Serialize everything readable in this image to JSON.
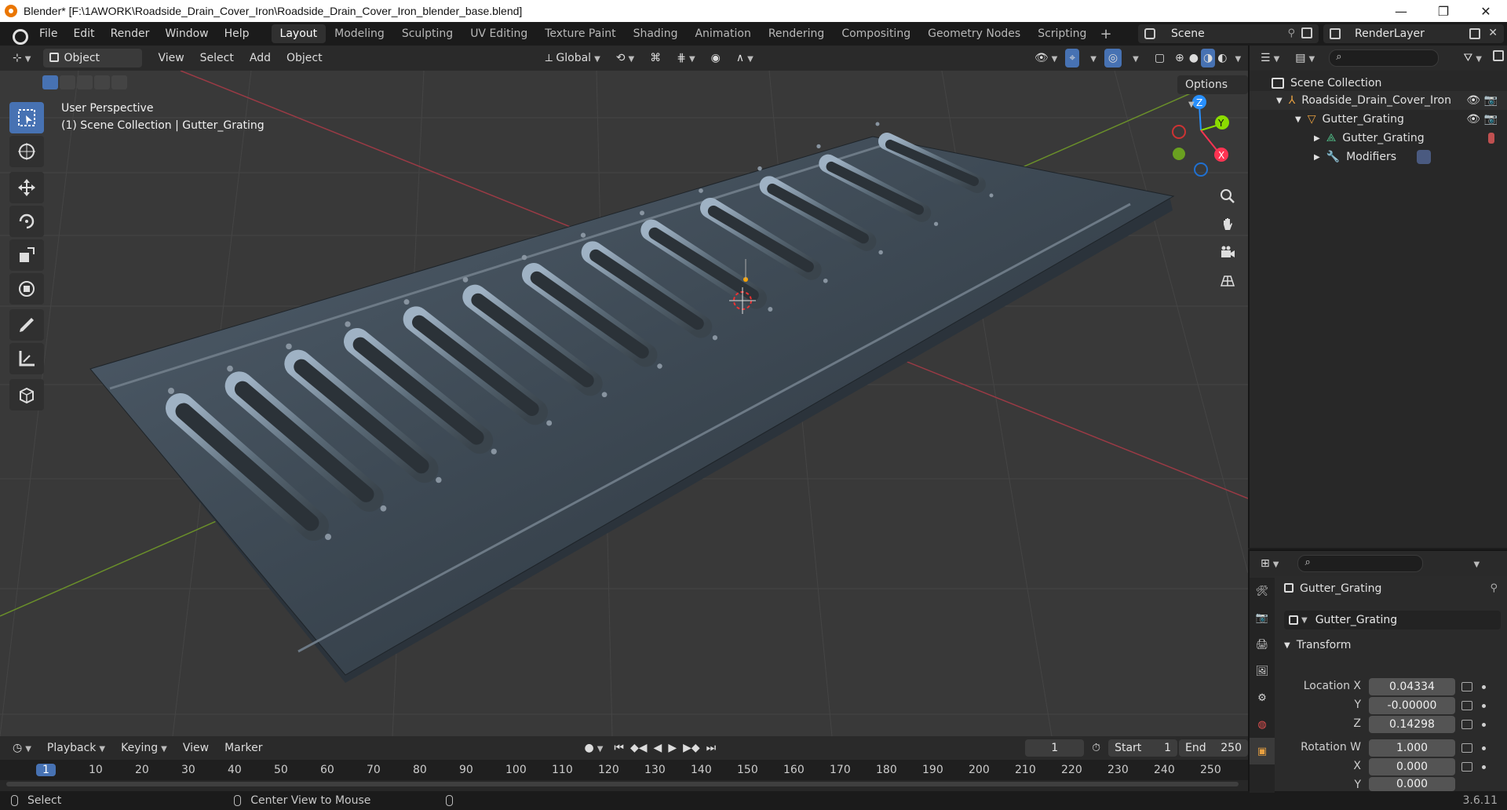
{
  "window": {
    "title": "Blender* [F:\\1AWORK\\Roadside_Drain_Cover_Iron\\Roadside_Drain_Cover_Iron_blender_base.blend]",
    "minimize": "—",
    "maximize": "❐",
    "close": "✕"
  },
  "menu": [
    "File",
    "Edit",
    "Render",
    "Window",
    "Help"
  ],
  "workspaces": [
    "Layout",
    "Modeling",
    "Sculpting",
    "UV Editing",
    "Texture Paint",
    "Shading",
    "Animation",
    "Rendering",
    "Compositing",
    "Geometry Nodes",
    "Scripting"
  ],
  "active_workspace": "Layout",
  "scene_name": "Scene",
  "render_layer": "RenderLayer",
  "viewport_header": {
    "mode": "Object Mode",
    "menus": [
      "View",
      "Select",
      "Add",
      "Object"
    ],
    "transform_orientation": "Global",
    "options": "Options"
  },
  "viewport": {
    "perspective": "User Perspective",
    "collection_info": "(1) Scene Collection | Gutter_Grating",
    "gizmo": {
      "x": "X",
      "y": "Y",
      "z": "Z"
    }
  },
  "outliner": {
    "root": "Scene Collection",
    "items": [
      {
        "label": "Roadside_Drain_Cover_Iron",
        "level": 1
      },
      {
        "label": "Gutter_Grating",
        "level": 2
      },
      {
        "label": "Gutter_Grating",
        "level": 3
      },
      {
        "label": "Modifiers",
        "level": 3
      }
    ]
  },
  "properties": {
    "object_name": "Gutter_Grating",
    "data_name": "Gutter_Grating",
    "panel": "Transform",
    "location_label": "Location X",
    "location": {
      "x": "0.04334",
      "y": "-0.00000",
      "z": "0.14298"
    },
    "rotation_label": "Rotation W",
    "rotation": {
      "w": "1.000",
      "x": "0.000",
      "y": "0.000"
    },
    "axis_labels": {
      "y": "Y",
      "z": "Z",
      "x": "X"
    }
  },
  "timeline": {
    "menus": [
      "Playback",
      "Keying",
      "View",
      "Marker"
    ],
    "current_frame": "1",
    "start_label": "Start",
    "start": "1",
    "end_label": "End",
    "end": "250",
    "ticks": [
      "1",
      "10",
      "20",
      "30",
      "40",
      "50",
      "60",
      "70",
      "80",
      "90",
      "100",
      "110",
      "120",
      "130",
      "140",
      "150",
      "160",
      "170",
      "180",
      "190",
      "200",
      "210",
      "220",
      "230",
      "240",
      "250"
    ]
  },
  "statusbar": {
    "left": "Select",
    "middle": "Center View to Mouse",
    "version": "3.6.11"
  },
  "colors": {
    "accent": "#4772b3",
    "axis_x": "#ff3352",
    "axis_y": "#8bdc00",
    "axis_z": "#2890ff"
  }
}
